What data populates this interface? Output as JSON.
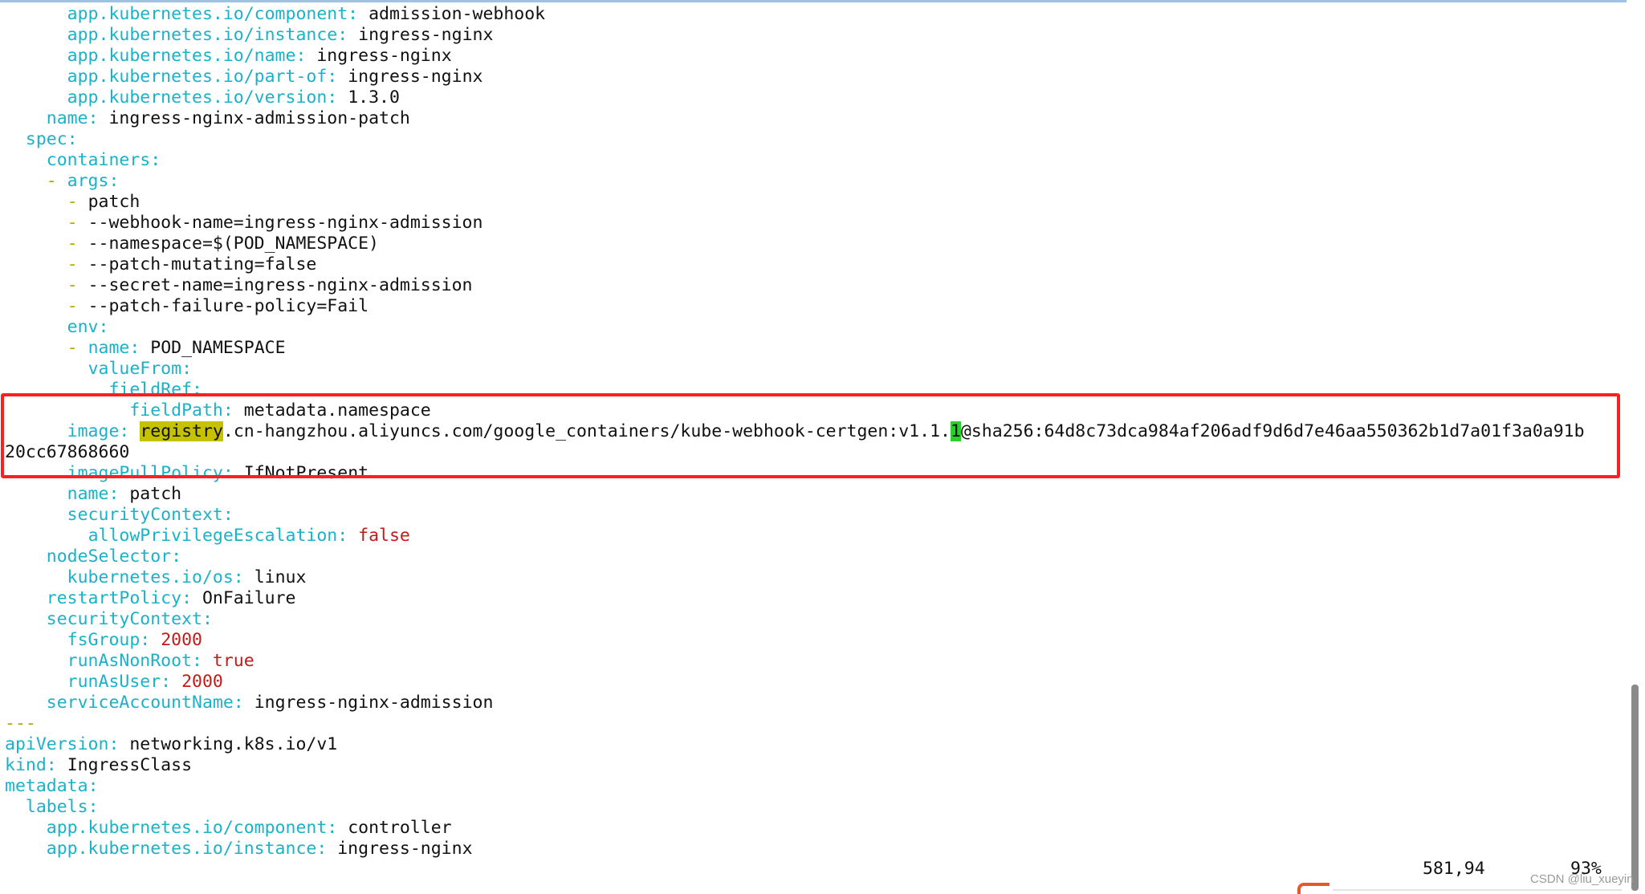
{
  "colors": {
    "key": "#1ab2c9",
    "dash": "#b9a400",
    "value": "#111111",
    "literal": "#c41a1a",
    "search_highlight": "#c6c200",
    "cursor": "#2ad12a",
    "annotation_box": "#ff1f1f"
  },
  "lines": [
    {
      "indent": "      ",
      "dash": "",
      "key": "app.kubernetes.io/component",
      "value": "admission-webhook"
    },
    {
      "indent": "      ",
      "dash": "",
      "key": "app.kubernetes.io/instance",
      "value": "ingress-nginx"
    },
    {
      "indent": "      ",
      "dash": "",
      "key": "app.kubernetes.io/name",
      "value": "ingress-nginx"
    },
    {
      "indent": "      ",
      "dash": "",
      "key": "app.kubernetes.io/part-of",
      "value": "ingress-nginx"
    },
    {
      "indent": "      ",
      "dash": "",
      "key": "app.kubernetes.io/version",
      "value": "1.3.0"
    },
    {
      "indent": "    ",
      "dash": "",
      "key": "name",
      "value": "ingress-nginx-admission-patch"
    },
    {
      "indent": "  ",
      "dash": "",
      "key": "spec",
      "value": ""
    },
    {
      "indent": "    ",
      "dash": "",
      "key": "containers",
      "value": ""
    },
    {
      "indent": "    ",
      "dash": "- ",
      "key": "args",
      "value": ""
    },
    {
      "indent": "      ",
      "dash": "- ",
      "key": "",
      "value": "patch"
    },
    {
      "indent": "      ",
      "dash": "- ",
      "key": "",
      "value": "--webhook-name=ingress-nginx-admission"
    },
    {
      "indent": "      ",
      "dash": "- ",
      "key": "",
      "value": "--namespace=$(POD_NAMESPACE)"
    },
    {
      "indent": "      ",
      "dash": "- ",
      "key": "",
      "value": "--patch-mutating=false"
    },
    {
      "indent": "      ",
      "dash": "- ",
      "key": "",
      "value": "--secret-name=ingress-nginx-admission"
    },
    {
      "indent": "      ",
      "dash": "- ",
      "key": "",
      "value": "--patch-failure-policy=Fail"
    },
    {
      "indent": "      ",
      "dash": "",
      "key": "env",
      "value": ""
    },
    {
      "indent": "      ",
      "dash": "- ",
      "key": "name",
      "value": "POD_NAMESPACE"
    },
    {
      "indent": "        ",
      "dash": "",
      "key": "valueFrom",
      "value": ""
    },
    {
      "indent": "          ",
      "dash": "",
      "key": "fieldRef",
      "value": ""
    },
    {
      "indent": "            ",
      "dash": "",
      "key": "fieldPath",
      "value": "metadata.namespace"
    },
    {
      "indent": "      ",
      "dash": "",
      "key": "image",
      "value": "",
      "special": "image"
    },
    {
      "indent": "",
      "dash": "",
      "key": "",
      "value": "20cc67868660"
    },
    {
      "indent": "      ",
      "dash": "",
      "key": "imagePullPolicy",
      "value": "IfNotPresent"
    },
    {
      "indent": "      ",
      "dash": "",
      "key": "name",
      "value": "patch"
    },
    {
      "indent": "      ",
      "dash": "",
      "key": "securityContext",
      "value": ""
    },
    {
      "indent": "        ",
      "dash": "",
      "key": "allowPrivilegeEscalation",
      "value": "false",
      "literal": true
    },
    {
      "indent": "    ",
      "dash": "",
      "key": "nodeSelector",
      "value": ""
    },
    {
      "indent": "      ",
      "dash": "",
      "key": "kubernetes.io/os",
      "value": "linux"
    },
    {
      "indent": "    ",
      "dash": "",
      "key": "restartPolicy",
      "value": "OnFailure"
    },
    {
      "indent": "    ",
      "dash": "",
      "key": "securityContext",
      "value": ""
    },
    {
      "indent": "      ",
      "dash": "",
      "key": "fsGroup",
      "value": "2000",
      "literal": true
    },
    {
      "indent": "      ",
      "dash": "",
      "key": "runAsNonRoot",
      "value": "true",
      "literal": true
    },
    {
      "indent": "      ",
      "dash": "",
      "key": "runAsUser",
      "value": "2000",
      "literal": true
    },
    {
      "indent": "    ",
      "dash": "",
      "key": "serviceAccountName",
      "value": "ingress-nginx-admission"
    },
    {
      "indent": "",
      "dash": "",
      "key": "",
      "value": "",
      "separator": "---"
    },
    {
      "indent": "",
      "dash": "",
      "key": "apiVersion",
      "value": "networking.k8s.io/v1"
    },
    {
      "indent": "",
      "dash": "",
      "key": "kind",
      "value": "IngressClass"
    },
    {
      "indent": "",
      "dash": "",
      "key": "metadata",
      "value": ""
    },
    {
      "indent": "  ",
      "dash": "",
      "key": "labels",
      "value": ""
    },
    {
      "indent": "    ",
      "dash": "",
      "key": "app.kubernetes.io/component",
      "value": "controller"
    },
    {
      "indent": "    ",
      "dash": "",
      "key": "app.kubernetes.io/instance",
      "value": "ingress-nginx"
    }
  ],
  "image_line": {
    "search_match": "registry",
    "before_cursor": ".cn-hangzhou.aliyuncs.com/google_containers/kube-webhook-certgen:v1.1.",
    "cursor_char": "1",
    "after_cursor": "@sha256:64d8c73dca984af206adf9d6d7e46aa550362b1d7a01f3a0a91b"
  },
  "status": {
    "position": "581,94",
    "percent": "93%"
  },
  "watermark": "CSDN @liu_xueyin"
}
